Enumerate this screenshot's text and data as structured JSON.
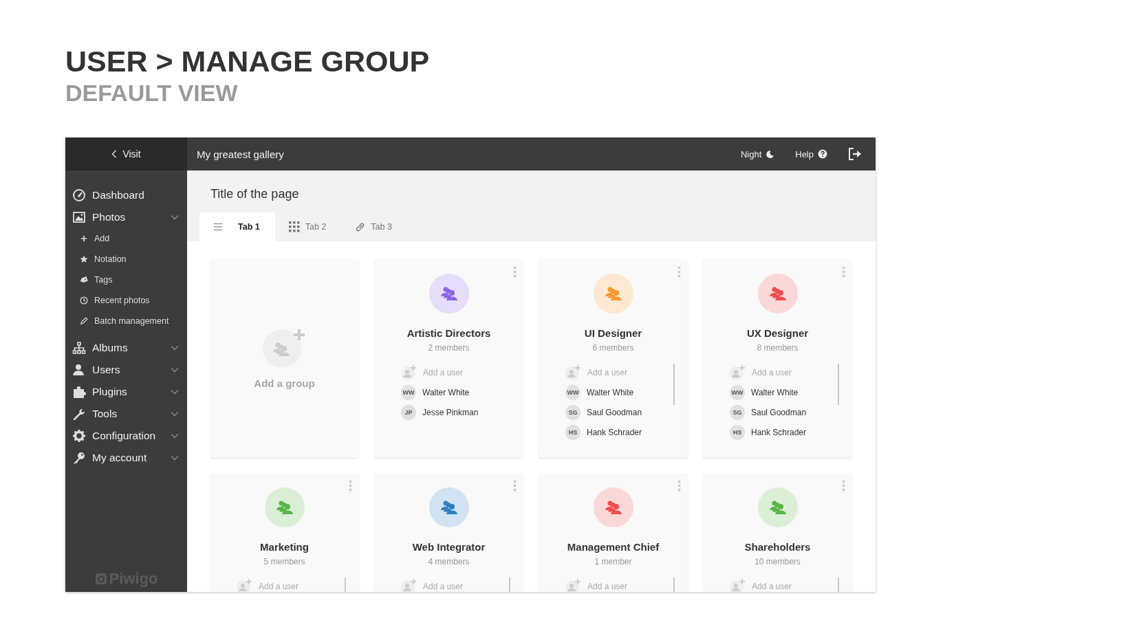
{
  "heading": {
    "title": "USER > MANAGE GROUP",
    "subtitle": "DEFAULT VIEW"
  },
  "sidebar": {
    "visit": "Visit",
    "items": [
      {
        "label": "Dashboard"
      },
      {
        "label": "Photos",
        "children": [
          {
            "label": "Add"
          },
          {
            "label": "Notation"
          },
          {
            "label": "Tags"
          },
          {
            "label": "Recent photos"
          },
          {
            "label": "Batch management"
          }
        ]
      },
      {
        "label": "Albums"
      },
      {
        "label": "Users"
      },
      {
        "label": "Plugins"
      },
      {
        "label": "Tools"
      },
      {
        "label": "Configuration"
      },
      {
        "label": "My account"
      }
    ],
    "logo": "Piwigo"
  },
  "topbar": {
    "gallery": "My greatest gallery",
    "night": "Night",
    "help": "Help"
  },
  "page": {
    "title": "Title of the page",
    "tabs": [
      {
        "label": "Tab 1",
        "selected": true
      },
      {
        "label": "Tab 2",
        "selected": false
      },
      {
        "label": "Tab 3",
        "selected": false
      }
    ]
  },
  "add_group": "Add a group",
  "groups": [
    {
      "name": "Artistic Directors",
      "count": "2 members",
      "color": "#8e63e6",
      "add_user": "Add a user",
      "scrollbar": false,
      "members": [
        {
          "initials": "WW",
          "name": "Walter White"
        },
        {
          "initials": "JP",
          "name": "Jesse Pinkman"
        }
      ]
    },
    {
      "name": "UI Designer",
      "count": "6 members",
      "color": "#f59a33",
      "add_user": "Add a user",
      "scrollbar": true,
      "members": [
        {
          "initials": "WW",
          "name": "Walter White"
        },
        {
          "initials": "SG",
          "name": "Saul Goodman"
        },
        {
          "initials": "HS",
          "name": "Hank Schrader"
        }
      ]
    },
    {
      "name": "UX Designer",
      "count": "8 members",
      "color": "#ef4d4d",
      "add_user": "Add a user",
      "scrollbar": true,
      "members": [
        {
          "initials": "WW",
          "name": "Walter White"
        },
        {
          "initials": "SG",
          "name": "Saul Goodman"
        },
        {
          "initials": "HS",
          "name": "Hank Schrader"
        }
      ]
    },
    {
      "name": "Marketing",
      "count": "5 members",
      "color": "#5ab54a",
      "add_user": "Add a user",
      "scrollbar": true
    },
    {
      "name": "Web Integrator",
      "count": "4 members",
      "color": "#2e7fc4",
      "add_user": "Add a user",
      "scrollbar": true
    },
    {
      "name": "Management Chief",
      "count": "1 member",
      "color": "#ef4d4d",
      "add_user": "Add a user",
      "scrollbar": true
    },
    {
      "name": "Shareholders",
      "count": "10 members",
      "color": "#5ab54a",
      "add_user": "Add a user",
      "scrollbar": true
    }
  ]
}
